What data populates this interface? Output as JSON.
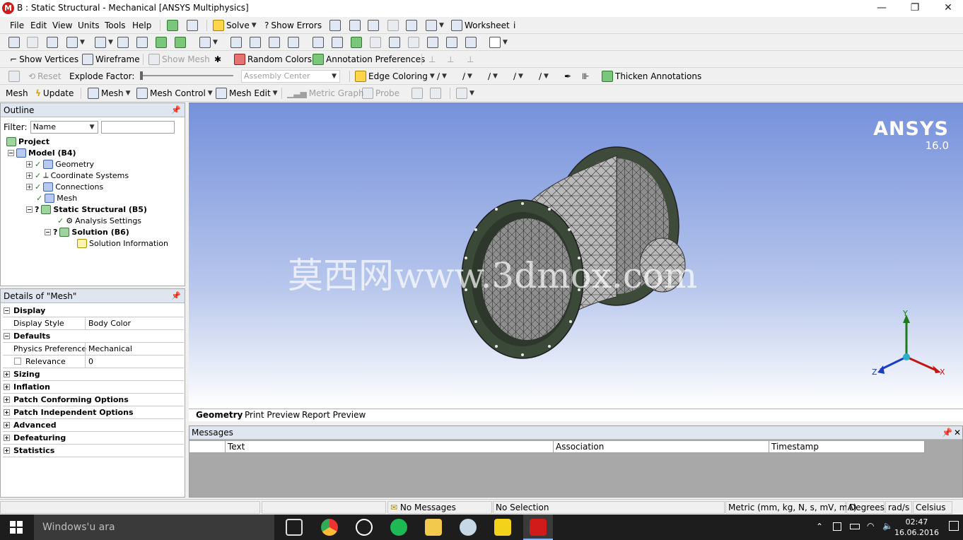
{
  "window": {
    "title": "B : Static Structural - Mechanical [ANSYS Multiphysics]",
    "logo_letter": "M",
    "minimize": "—",
    "maximize": "❐",
    "close": "✕"
  },
  "menu": {
    "items": [
      "File",
      "Edit",
      "View",
      "Units",
      "Tools",
      "Help"
    ],
    "solve": "Solve",
    "show_errors": "Show Errors",
    "worksheet": "Worksheet"
  },
  "toolbar2": {
    "show_vertices": "Show Vertices",
    "wireframe": "Wireframe",
    "show_mesh": "Show Mesh",
    "random_colors": "Random Colors",
    "annotation_preferences": "Annotation Preferences"
  },
  "toolbar3": {
    "reset": "Reset",
    "explode_factor": "Explode Factor:",
    "assembly_center": "Assembly Center",
    "edge_coloring": "Edge Coloring",
    "thicken_annotations": "Thicken Annotations"
  },
  "toolbar4": {
    "mesh": "Mesh",
    "update": "Update",
    "mesh_menu": "Mesh",
    "mesh_control": "Mesh Control",
    "mesh_edit": "Mesh Edit",
    "metric_graph": "Metric Graph",
    "probe": "Probe"
  },
  "outline": {
    "header": "Outline",
    "filter_label": "Filter:",
    "filter_value": "Name",
    "tree": {
      "project": "Project",
      "model": "Model (B4)",
      "geometry": "Geometry",
      "coordinate_systems": "Coordinate Systems",
      "connections": "Connections",
      "mesh": "Mesh",
      "static_structural": "Static Structural (B5)",
      "analysis_settings": "Analysis Settings",
      "solution": "Solution (B6)",
      "solution_information": "Solution Information"
    }
  },
  "details": {
    "header": "Details of \"Mesh\"",
    "rows": {
      "display": "Display",
      "display_style": "Display Style",
      "display_style_val": "Body Color",
      "defaults": "Defaults",
      "physics_pref": "Physics Preference",
      "physics_pref_val": "Mechanical",
      "relevance": "Relevance",
      "relevance_val": "0",
      "sizing": "Sizing",
      "inflation": "Inflation",
      "patch_conforming": "Patch Conforming Options",
      "patch_independent": "Patch Independent Options",
      "advanced": "Advanced",
      "defeaturing": "Defeaturing",
      "statistics": "Statistics"
    }
  },
  "viewport": {
    "logo": "ANSYS",
    "version": "16.0",
    "watermark": "莫西网www.3dmox.com",
    "axis_x": "X",
    "axis_y": "Y",
    "axis_z": "Z"
  },
  "view_tabs": [
    "Geometry",
    "Print Preview",
    "Report Preview"
  ],
  "messages": {
    "header": "Messages",
    "columns": [
      "Text",
      "Association",
      "Timestamp"
    ]
  },
  "status": {
    "messages": "No Messages",
    "selection": "No Selection",
    "units": "Metric (mm, kg, N, s, mV, mA)",
    "angle": "Degrees",
    "angular_velocity": "rad/s",
    "temperature": "Celsius"
  },
  "taskbar": {
    "search": "Windows'u ara",
    "time": "02:47",
    "date": "16.06.2016"
  },
  "colors": {
    "accent": "#d11b1b",
    "viewport_top": "#7691dc",
    "viewport_bottom": "#ffffff"
  }
}
